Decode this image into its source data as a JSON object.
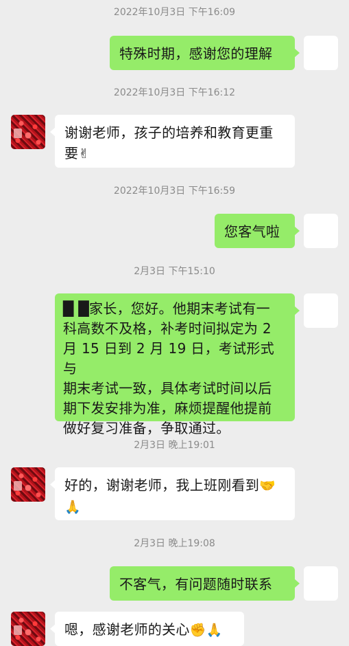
{
  "messages": [
    {
      "type": "time",
      "text": "2022年10月3日 下午16:09"
    },
    {
      "type": "out",
      "text": "特殊时期，感谢您的理解"
    },
    {
      "type": "time",
      "text": "2022年10月3日 下午16:12"
    },
    {
      "type": "in",
      "text_line1": "谢谢老师，孩子的培养和教育更重",
      "text_line2": "要",
      "emoji": "✌"
    },
    {
      "type": "time",
      "text": "2022年10月3日 下午16:59"
    },
    {
      "type": "out",
      "text": "您客气啦"
    },
    {
      "type": "time",
      "text": "2月3日 下午15:10"
    },
    {
      "type": "out",
      "lines": [
        "█ █家长，您好。他期末考试有一",
        "科高数不及格，补考时间拟定为 2",
        "月 15 日到 2 月 19 日，考试形式与",
        "期末考试一致，具体考试时间以后",
        "期下发安排为准，麻烦提醒他提前",
        "做好复习准备，争取通过。"
      ]
    },
    {
      "type": "time",
      "text": "2月3日 晚上19:01"
    },
    {
      "type": "in",
      "text_line1": "好的，谢谢老师，我上班刚看到",
      "emoji1": "🤝",
      "emoji2": "🙏"
    },
    {
      "type": "time",
      "text": "2月3日 晚上19:08"
    },
    {
      "type": "out",
      "text": "不客气，有问题随时联系"
    },
    {
      "type": "in",
      "text": "嗯，感谢老师的关心",
      "emoji1": "✊",
      "emoji2": "🙏"
    }
  ]
}
